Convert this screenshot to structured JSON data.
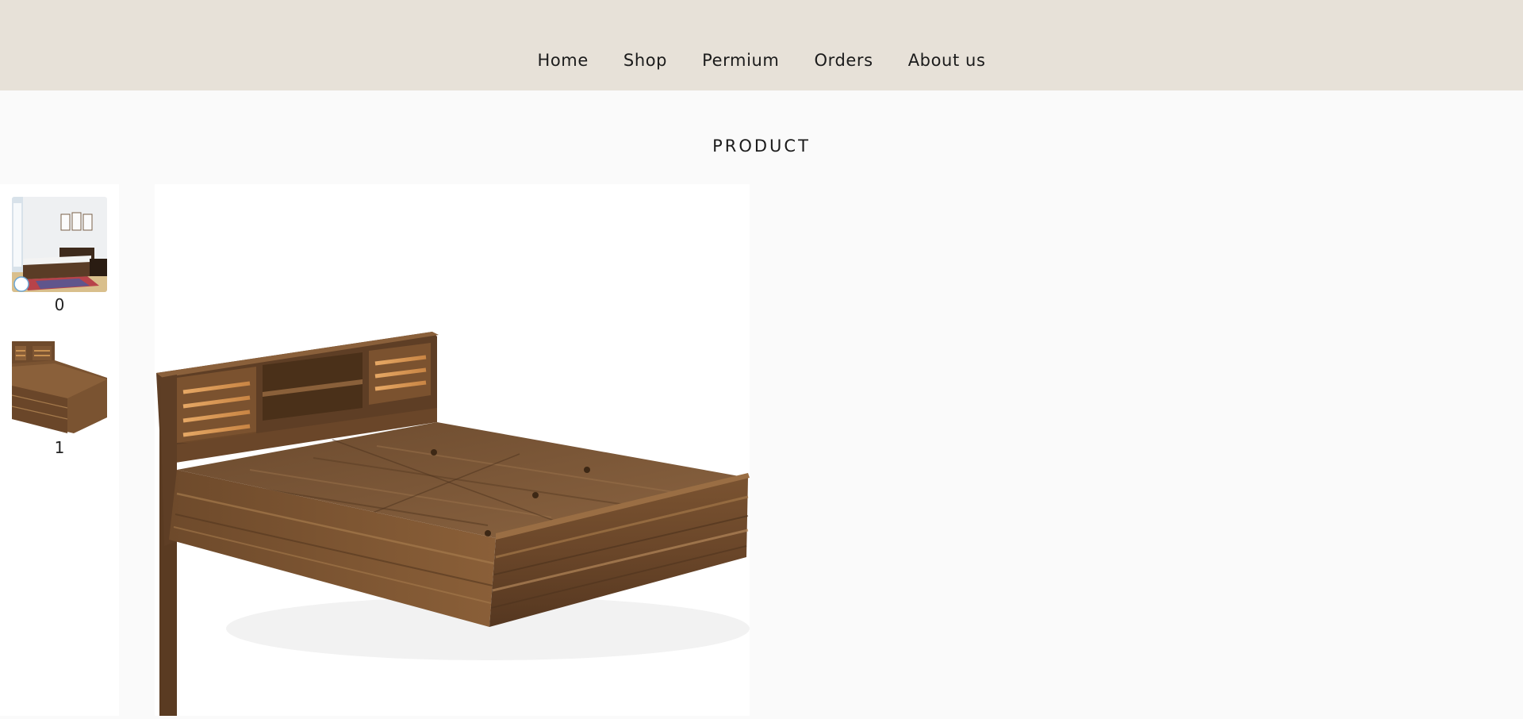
{
  "nav": {
    "items": [
      {
        "label": "Home"
      },
      {
        "label": "Shop"
      },
      {
        "label": "Permium"
      },
      {
        "label": "Orders"
      },
      {
        "label": "About us"
      }
    ]
  },
  "page": {
    "title": "PRODUCT"
  },
  "gallery": {
    "thumbnails": [
      {
        "label": "0",
        "icon": "bedroom-scene-image"
      },
      {
        "label": "1",
        "icon": "bed-closeup-image"
      }
    ],
    "main_image_icon": "wooden-storage-bed-image"
  },
  "colors": {
    "header_bg": "#e7e1d8",
    "page_bg": "#fafafa",
    "wood": "#6b4a2f"
  }
}
